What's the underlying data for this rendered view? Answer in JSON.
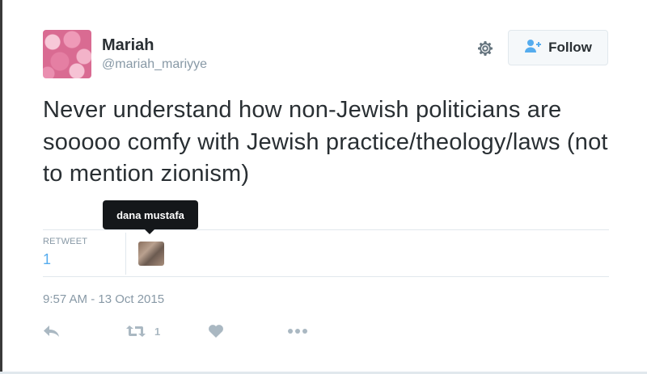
{
  "tweet": {
    "author": {
      "name": "Mariah",
      "handle": "@mariah_mariyye"
    },
    "follow_label": "Follow",
    "text": "Never understand how non-Jewish politicians are sooooo comfy with Jewish practice/theology/laws (not to mention zionism)",
    "stats": {
      "retweet_label": "RETWEET",
      "retweet_count": "1"
    },
    "tooltip": "dana mustafa",
    "timestamp": "9:57 AM - 13 Oct 2015",
    "actions": {
      "retweet_count": "1"
    }
  },
  "colors": {
    "accent": "#55acee",
    "muted": "#8899a6",
    "text": "#292f33"
  },
  "icons": [
    "gear-icon",
    "follow-person-icon",
    "reply-icon",
    "retweet-icon",
    "heart-icon",
    "more-icon"
  ]
}
